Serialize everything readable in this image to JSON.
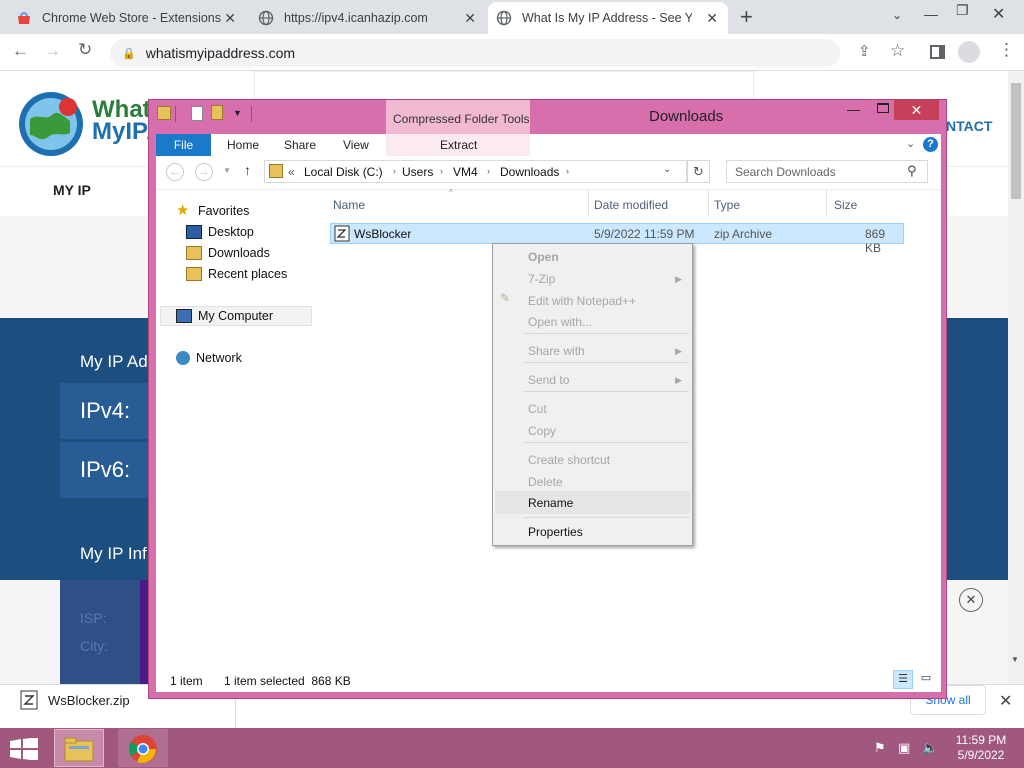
{
  "browser": {
    "tabs": [
      {
        "title": "Chrome Web Store - Extensions"
      },
      {
        "title": "https://ipv4.icanhazip.com"
      },
      {
        "title": "What Is My IP Address - See Your"
      }
    ],
    "url": "whatismyipaddress.com",
    "new_tab": "+"
  },
  "website": {
    "logo_line1": "WhatI",
    "logo_line2": "MyIPA",
    "nav_my_ip": "MY IP",
    "nav_contact": "NTACT",
    "section1": "My IP Ad",
    "ipv4": "IPv4:",
    "ipv6": "IPv6:",
    "section2": "My IP Inf",
    "row_isp": "ISP:",
    "row_city": "City:"
  },
  "explorer": {
    "title": "Downloads",
    "contextual_tab": "Compressed Folder Tools",
    "ribbon_tabs": {
      "file": "File",
      "home": "Home",
      "share": "Share",
      "view": "View",
      "extract": "Extract"
    },
    "breadcrumb": {
      "prefix": "«",
      "c1": "Local Disk (C:)",
      "c2": "Users",
      "c3": "VM4",
      "c4": "Downloads"
    },
    "search_placeholder": "Search Downloads",
    "nav": {
      "favorites": "Favorites",
      "desktop": "Desktop",
      "downloads": "Downloads",
      "recent": "Recent places",
      "computer": "My Computer",
      "network": "Network"
    },
    "columns": {
      "name": "Name",
      "date": "Date modified",
      "type": "Type",
      "size": "Size"
    },
    "file": {
      "name": "WsBlocker",
      "date": "5/9/2022 11:59 PM",
      "type": "zip Archive",
      "size": "869 KB"
    },
    "status": {
      "count": "1 item",
      "selected": "1 item selected  868 KB"
    }
  },
  "context_menu": {
    "open": "Open",
    "zip7": "7-Zip",
    "edit_npp": "Edit with Notepad++",
    "open_with": "Open with...",
    "share_with": "Share with",
    "send_to": "Send to",
    "cut": "Cut",
    "copy": "Copy",
    "create_shortcut": "Create shortcut",
    "delete": "Delete",
    "rename": "Rename",
    "properties": "Properties"
  },
  "downloads_bar": {
    "file": "WsBlocker.zip",
    "show_all": "Show all"
  },
  "taskbar": {
    "time": "11:59 PM",
    "date": "5/9/2022"
  }
}
